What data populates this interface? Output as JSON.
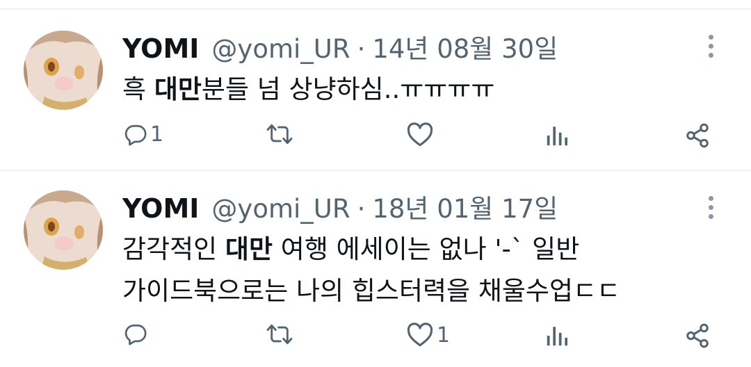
{
  "tweets": [
    {
      "name": "YOMI",
      "handle": "@yomi_UR",
      "separator": "·",
      "date": "14년 08월 30일",
      "text_lines": [
        {
          "before": "흑 ",
          "bold": "대만",
          "after": "분들 넘 상냥하심..ㅠㅠㅠㅠ"
        }
      ],
      "reply_count": "1",
      "like_count": ""
    },
    {
      "name": "YOMI",
      "handle": "@yomi_UR",
      "separator": "·",
      "date": "18년 01월 17일",
      "text_lines": [
        {
          "before": "감각적인 ",
          "bold": "대만",
          "after": " 여행 에세이는 없나 '-` 일반"
        },
        {
          "before": "가이드북으로는 나의 힙스터력을 채울수업ㄷㄷ",
          "bold": "",
          "after": ""
        }
      ],
      "reply_count": "",
      "like_count": "1"
    }
  ],
  "icons": {
    "reply": "reply-icon",
    "retweet": "retweet-icon",
    "like": "heart-icon",
    "views": "views-chart-icon",
    "share": "share-icon",
    "more": "more-vertical-icon"
  },
  "colors": {
    "text": "#0f1419",
    "secondary": "#536471",
    "divider": "#eff3f4"
  }
}
